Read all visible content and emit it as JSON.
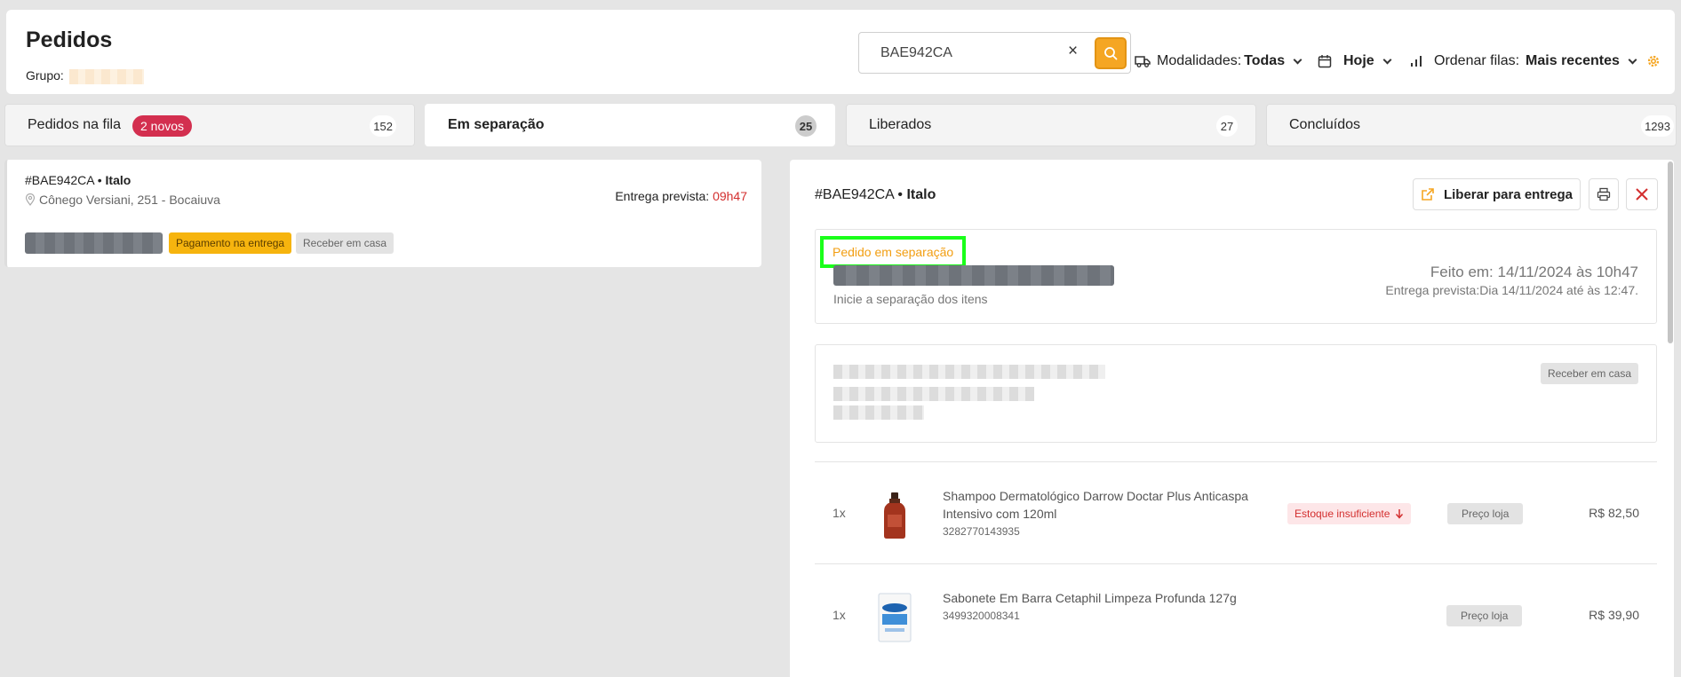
{
  "header": {
    "title": "Pedidos",
    "group_label": "Grupo:",
    "search": {
      "value": "BAE942CA",
      "clear": "×"
    },
    "filters": {
      "modality_label": "Modalidades:",
      "modality_value": "Todas",
      "date_value": "Hoje",
      "order_label": "Ordenar filas:",
      "order_value": "Mais recentes"
    },
    "icons": [
      "search-icon",
      "truck-icon",
      "calendar-icon",
      "bars-icon",
      "gear-icon"
    ]
  },
  "tabs": [
    {
      "label": "Pedidos na fila",
      "badge": "2 novos",
      "count": "152"
    },
    {
      "label": "Em separação",
      "count": "25",
      "active": true
    },
    {
      "label": "Liberados",
      "count": "27"
    },
    {
      "label": "Concluídos",
      "count": "1293"
    }
  ],
  "order_card": {
    "id": "#BAE942CA",
    "customer": "Italo",
    "address": "Cônego Versiani, 251 - Bocaiuva",
    "eta_label": "Entrega prevista:",
    "eta_time": "09h47",
    "payment_tag": "Pagamento na entrega",
    "delivery_tag": "Receber em casa"
  },
  "detail": {
    "id": "#BAE942CA",
    "customer": "Italo",
    "release_label": "Liberar para entrega",
    "status": "Pedido em separação",
    "hint": "Inicie a separação dos itens",
    "made_at": "Feito em: 14/11/2024 às 10h47",
    "eta": "Entrega prevista:Dia 14/11/2024 até às 12:47.",
    "delivery_tag": "Receber em casa",
    "items": [
      {
        "qty": "1x",
        "name": "Shampoo Dermatológico Darrow Doctar Plus Anticaspa Intensivo com 120ml",
        "code": "3282770143935",
        "stock": "Estoque insuficiente",
        "price_button": "Preço loja",
        "price": "R$ 82,50"
      },
      {
        "qty": "1x",
        "name": "Sabonete Em Barra Cetaphil Limpeza Profunda 127g",
        "code": "3499320008341",
        "price_button": "Preço loja",
        "price": "R$ 39,90"
      }
    ]
  },
  "colors": {
    "accent": "#f5a623",
    "danger": "#d32f2f",
    "badge": "#d32f4f",
    "highlight": "#1aff1a",
    "status": "#f29e11"
  }
}
